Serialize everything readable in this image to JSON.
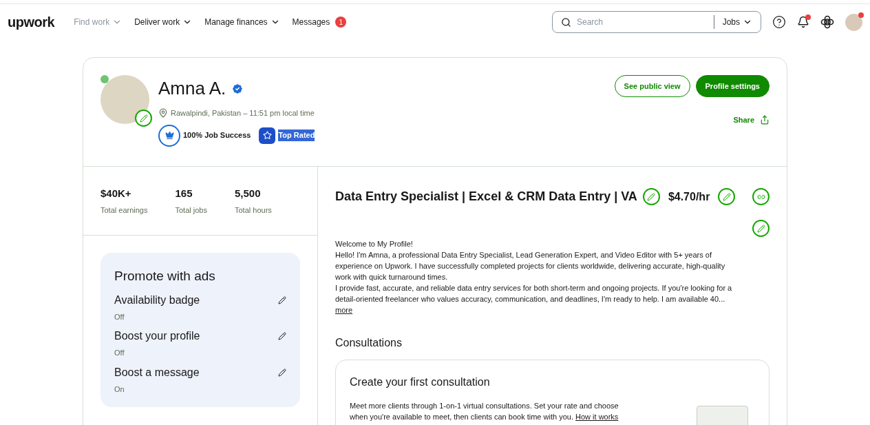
{
  "nav": {
    "logo": "upwork",
    "items": [
      {
        "label": "Find work",
        "muted": true,
        "caret": true
      },
      {
        "label": "Deliver work",
        "muted": false,
        "caret": true
      },
      {
        "label": "Manage finances",
        "muted": false,
        "caret": true
      },
      {
        "label": "Messages",
        "muted": false,
        "caret": false,
        "badge": "1"
      }
    ],
    "search": {
      "placeholder": "Search",
      "scope": "Jobs"
    },
    "notifications_unread": true,
    "avatar_unread": true
  },
  "profile": {
    "name": "Amna A.",
    "verified": true,
    "online": true,
    "location": "Rawalpindi, Pakistan – 11:51 pm local time",
    "badges": [
      {
        "kind": "job_success",
        "label": "100% Job Success",
        "highlighted": false
      },
      {
        "kind": "top_rated",
        "label": "Top Rated",
        "highlighted": true
      }
    ],
    "buttons": [
      {
        "label": "See public view",
        "kind": "outline"
      },
      {
        "label": "Profile settings",
        "kind": "solid"
      }
    ],
    "share": "Share"
  },
  "stats": [
    {
      "value": "$40K+",
      "label": "Total earnings"
    },
    {
      "value": "165",
      "label": "Total jobs"
    },
    {
      "value": "5,500",
      "label": "Total hours"
    }
  ],
  "promote": {
    "title": "Promote with ads",
    "items": [
      {
        "label": "Availability badge",
        "status": "Off"
      },
      {
        "label": "Boost your profile",
        "status": "Off"
      },
      {
        "label": "Boost a message",
        "status": "On"
      }
    ]
  },
  "overview": {
    "title": "Data Entry Specialist | Excel & CRM Data Entry | VA",
    "rate": "$4.70/hr",
    "paragraphs": [
      "Welcome to My Profile!",
      "Hello! I'm Amna, a professional Data Entry Specialist, Lead Generation Expert, and Video Editor with 5+ years of experience on Upwork. I have successfully completed projects for clients worldwide, delivering accurate, high-quality work with quick turnaround times.",
      "I provide fast, accurate, and reliable data entry services for both short-term and ongoing projects. If you're looking for a detail-oriented freelancer who values accuracy, communication, and deadlines, I'm ready to help. I am available 40..."
    ],
    "more": "more"
  },
  "consultations": {
    "heading": "Consultations",
    "card_title": "Create your first consultation",
    "text": "Meet more clients through 1-on-1 virtual consultations. Set your rate and choose when you're available to meet, then clients can book time with you.",
    "link": "How it works"
  }
}
